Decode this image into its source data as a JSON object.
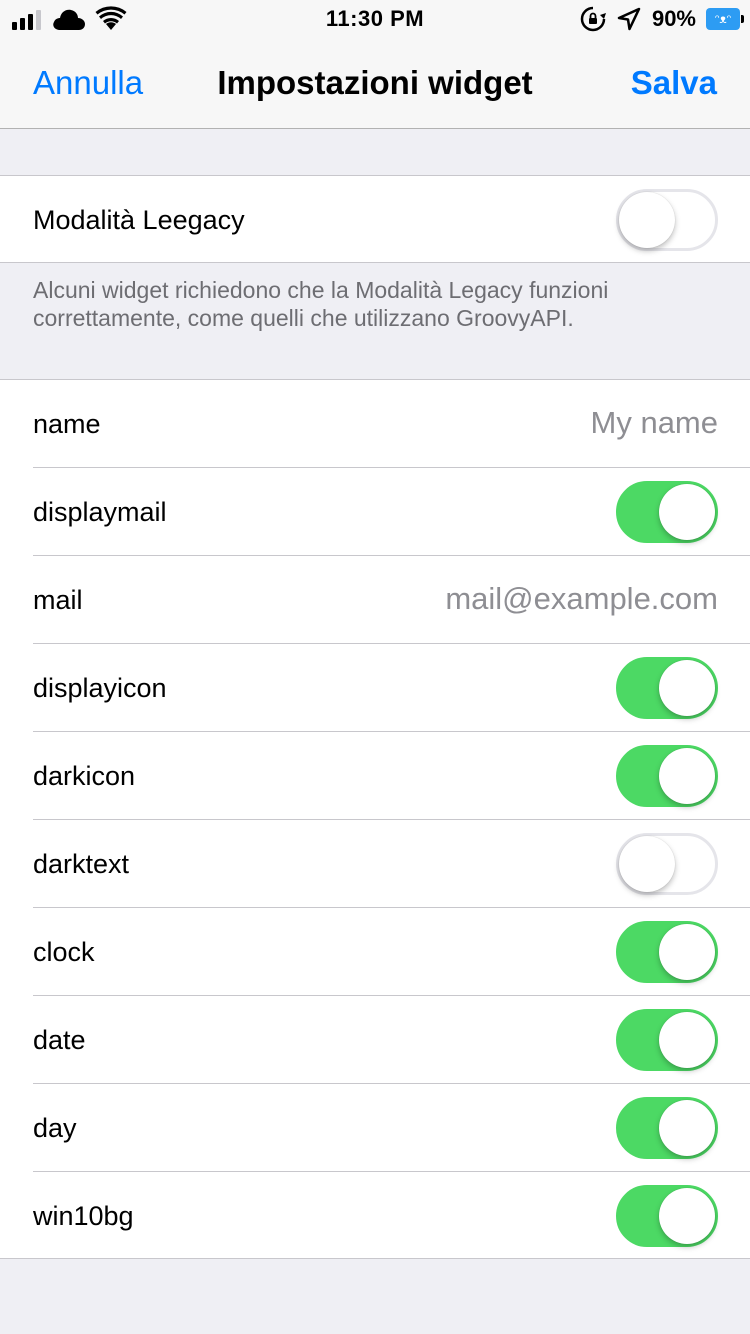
{
  "status_bar": {
    "time": "11:30 PM",
    "battery_percent": "90%",
    "battery_color": "#2d9cf3",
    "battery_face": "ᵔᴥᵔ",
    "icons": [
      "signal-icon",
      "cloud-icon",
      "wifi-icon",
      "rotation-lock-icon",
      "location-icon",
      "battery-icon"
    ]
  },
  "nav": {
    "cancel_label": "Annulla",
    "title": "Impostazioni widget",
    "save_label": "Salva",
    "accent_color": "#007aff"
  },
  "legacy": {
    "label": "Modalità Leegacy",
    "on": false,
    "footer": "Alcuni widget richiedono che la Modalità Legacy funzioni correttamente, come quelli che utilizzano GroovyAPI."
  },
  "settings": [
    {
      "label": "name",
      "kind": "text",
      "placeholder": "My name"
    },
    {
      "label": "displaymail",
      "kind": "toggle",
      "on": true
    },
    {
      "label": "mail",
      "kind": "text",
      "placeholder": "mail@example.com"
    },
    {
      "label": "displayicon",
      "kind": "toggle",
      "on": true
    },
    {
      "label": "darkicon",
      "kind": "toggle",
      "on": true
    },
    {
      "label": "darktext",
      "kind": "toggle",
      "on": false
    },
    {
      "label": "clock",
      "kind": "toggle",
      "on": true
    },
    {
      "label": "date",
      "kind": "toggle",
      "on": true
    },
    {
      "label": "day",
      "kind": "toggle",
      "on": true
    },
    {
      "label": "win10bg",
      "kind": "toggle",
      "on": true
    }
  ],
  "toggle_on_color": "#4cd964"
}
